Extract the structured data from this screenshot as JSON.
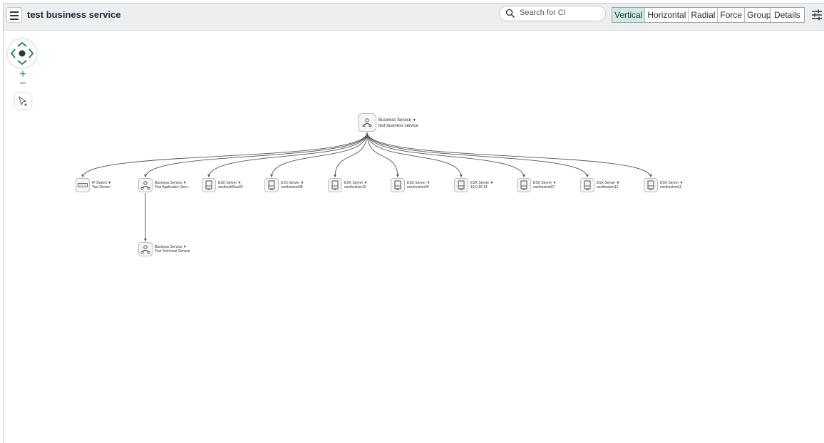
{
  "header": {
    "title": "test business service",
    "search_placeholder": "Search for CI",
    "layouts": [
      "Vertical",
      "Horizontal",
      "Radial",
      "Force",
      "Group"
    ],
    "active_layout": "Vertical",
    "details_label": "Details",
    "menu_icon": "hamburger-icon",
    "settings_icon": "sliders-icon"
  },
  "controls": {
    "pan_icon": "pan-icon",
    "zoom_in": "+",
    "zoom_out": "−",
    "select_icon": "select-cursor-icon"
  },
  "colors": {
    "accent": "#1f7a6b",
    "active_layout_bg": "#cfe9e3",
    "edge": "#555555"
  },
  "graph": {
    "root": {
      "type": "Business Service",
      "name": "test business service",
      "icon": "business-service-icon"
    },
    "children": [
      {
        "type": "IP Switch",
        "name": "Test Device",
        "icon": "switch-icon"
      },
      {
        "type": "Business Service",
        "name": "Test Application Serv...",
        "icon": "business-service-icon"
      },
      {
        "type": "ESX Server",
        "name": "esxihost65ux03",
        "icon": "server-icon"
      },
      {
        "type": "ESX Server",
        "name": "esxihostvm08",
        "icon": "server-icon"
      },
      {
        "type": "ESX Server",
        "name": "esxihostvm10",
        "icon": "server-icon"
      },
      {
        "type": "ESX Server",
        "name": "esxihostvm09",
        "icon": "server-icon"
      },
      {
        "type": "ESX Server",
        "name": "10.0.16.14",
        "icon": "server-icon"
      },
      {
        "type": "ESX Server",
        "name": "esxihostvm07",
        "icon": "server-icon"
      },
      {
        "type": "ESX Server",
        "name": "esxihostvm12",
        "icon": "server-icon"
      },
      {
        "type": "ESX Server",
        "name": "esxihostvm11",
        "icon": "server-icon"
      }
    ],
    "grandchild": {
      "type": "Business Service",
      "name": "Test Technical Service",
      "icon": "business-service-icon"
    }
  }
}
